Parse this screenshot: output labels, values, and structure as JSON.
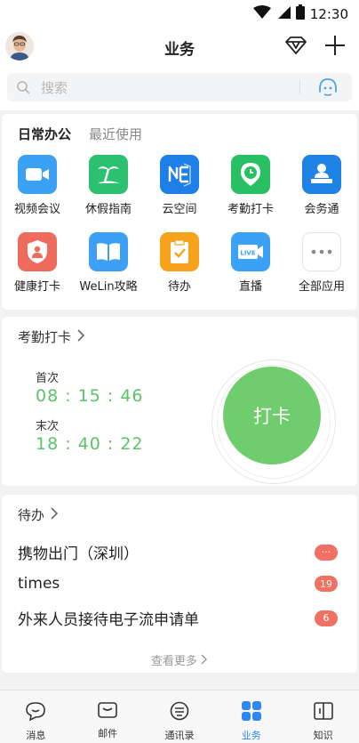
{
  "status": {
    "time": "12:30"
  },
  "header": {
    "title": "业务"
  },
  "search": {
    "placeholder": "搜索"
  },
  "office": {
    "tabs": [
      "日常办公",
      "最近使用"
    ],
    "apps": [
      {
        "label": "视频会议",
        "icon": "video-camera-icon",
        "color": "#3aa1f4"
      },
      {
        "label": "休假指南",
        "icon": "palm-tree-icon",
        "color": "#2cc071"
      },
      {
        "label": "云空间",
        "icon": "cloud-space-icon",
        "color": "#1e7fe8"
      },
      {
        "label": "考勤打卡",
        "icon": "clock-pin-icon",
        "color": "#28c063"
      },
      {
        "label": "会务通",
        "icon": "meeting-person-icon",
        "color": "#1f83e6"
      },
      {
        "label": "健康打卡",
        "icon": "health-shield-icon",
        "color": "#ef6b5d"
      },
      {
        "label": "WeLin攻略",
        "icon": "book-icon",
        "color": "#3ea0f4"
      },
      {
        "label": "待办",
        "icon": "clipboard-check-icon",
        "color": "#f7a21c"
      },
      {
        "label": "直播",
        "icon": "live-icon",
        "color": "#3aa1f4"
      },
      {
        "label": "全部应用",
        "icon": "more-dots-icon",
        "color": "#ffffff"
      }
    ]
  },
  "attendance": {
    "title": "考勤打卡",
    "first_label": "首次",
    "first_time": "08 : 15 : 46",
    "last_label": "末次",
    "last_time": "18 : 40 : 22",
    "button": "打卡"
  },
  "todo": {
    "title": "待办",
    "items": [
      {
        "text": "携物出门（深圳）",
        "badge": "···"
      },
      {
        "text": "times",
        "badge": "19"
      },
      {
        "text": "外来人员接待电子流申请单",
        "badge": "6"
      }
    ],
    "more": "查看更多"
  },
  "tabbar": {
    "items": [
      {
        "label": "消息",
        "active": false
      },
      {
        "label": "邮件",
        "active": false
      },
      {
        "label": "通讯录",
        "active": false
      },
      {
        "label": "业务",
        "active": true
      },
      {
        "label": "知识",
        "active": false
      }
    ]
  },
  "colors": {
    "accent": "#2f88ef",
    "green": "#6fcd6e",
    "badge": "#f07063"
  }
}
